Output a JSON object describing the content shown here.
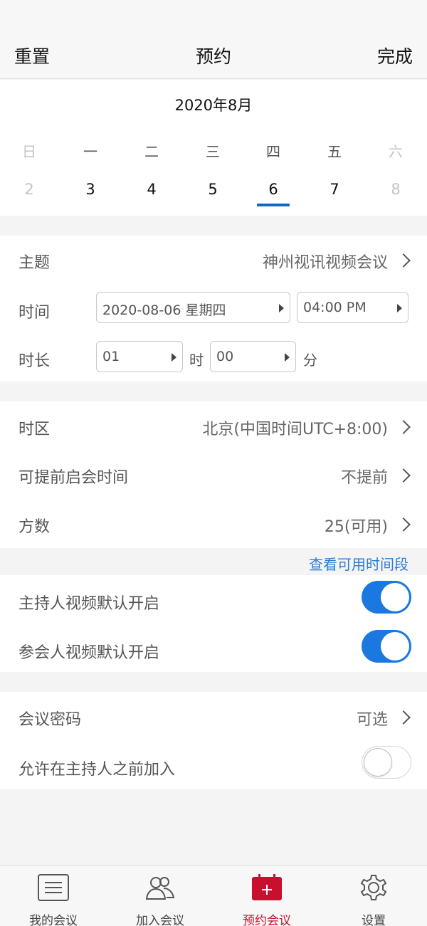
{
  "header": {
    "reset_label": "重置",
    "title": "预约",
    "done_label": "完成"
  },
  "calendar": {
    "month_label": "2020年8月",
    "weekdays": [
      "日",
      "一",
      "二",
      "三",
      "四",
      "五",
      "六"
    ],
    "dates": [
      "2",
      "3",
      "4",
      "5",
      "6",
      "7",
      "8"
    ],
    "selected_index": 4,
    "accent_color": "#1565c0"
  },
  "form": {
    "subject": {
      "label": "主题",
      "value": "神州视讯视频会议"
    },
    "time": {
      "label": "时间",
      "date": "2020-08-06 星期四",
      "clock": "04:00 PM"
    },
    "duration": {
      "label": "时长",
      "hours": "01",
      "hours_unit": "时",
      "minutes": "00",
      "minutes_unit": "分"
    }
  },
  "settings": {
    "timezone": {
      "label": "时区",
      "value": "北京(中国时间UTC+8:00)"
    },
    "early_start": {
      "label": "可提前启会时间",
      "value": "不提前"
    },
    "participants": {
      "label": "方数",
      "value": "25(可用)"
    },
    "available_link": "查看可用时间段"
  },
  "video": {
    "host_video": {
      "label": "主持人视频默认开启",
      "enabled": true
    },
    "attendee_video": {
      "label": "参会人视频默认开启",
      "enabled": true
    },
    "toggle_color": "#1b78e0"
  },
  "security": {
    "password": {
      "label": "会议密码",
      "value": "可选"
    },
    "join_before_host": {
      "label": "允许在主持人之前加入",
      "enabled": false
    }
  },
  "bottom_nav": {
    "items": [
      {
        "label": "我的会议",
        "icon": "list-icon"
      },
      {
        "label": "加入会议",
        "icon": "people-icon"
      },
      {
        "label": "预约会议",
        "icon": "calendar-plus-icon"
      },
      {
        "label": "设置",
        "icon": "gear-icon"
      }
    ],
    "active_index": 2,
    "active_color": "#c8102e"
  }
}
